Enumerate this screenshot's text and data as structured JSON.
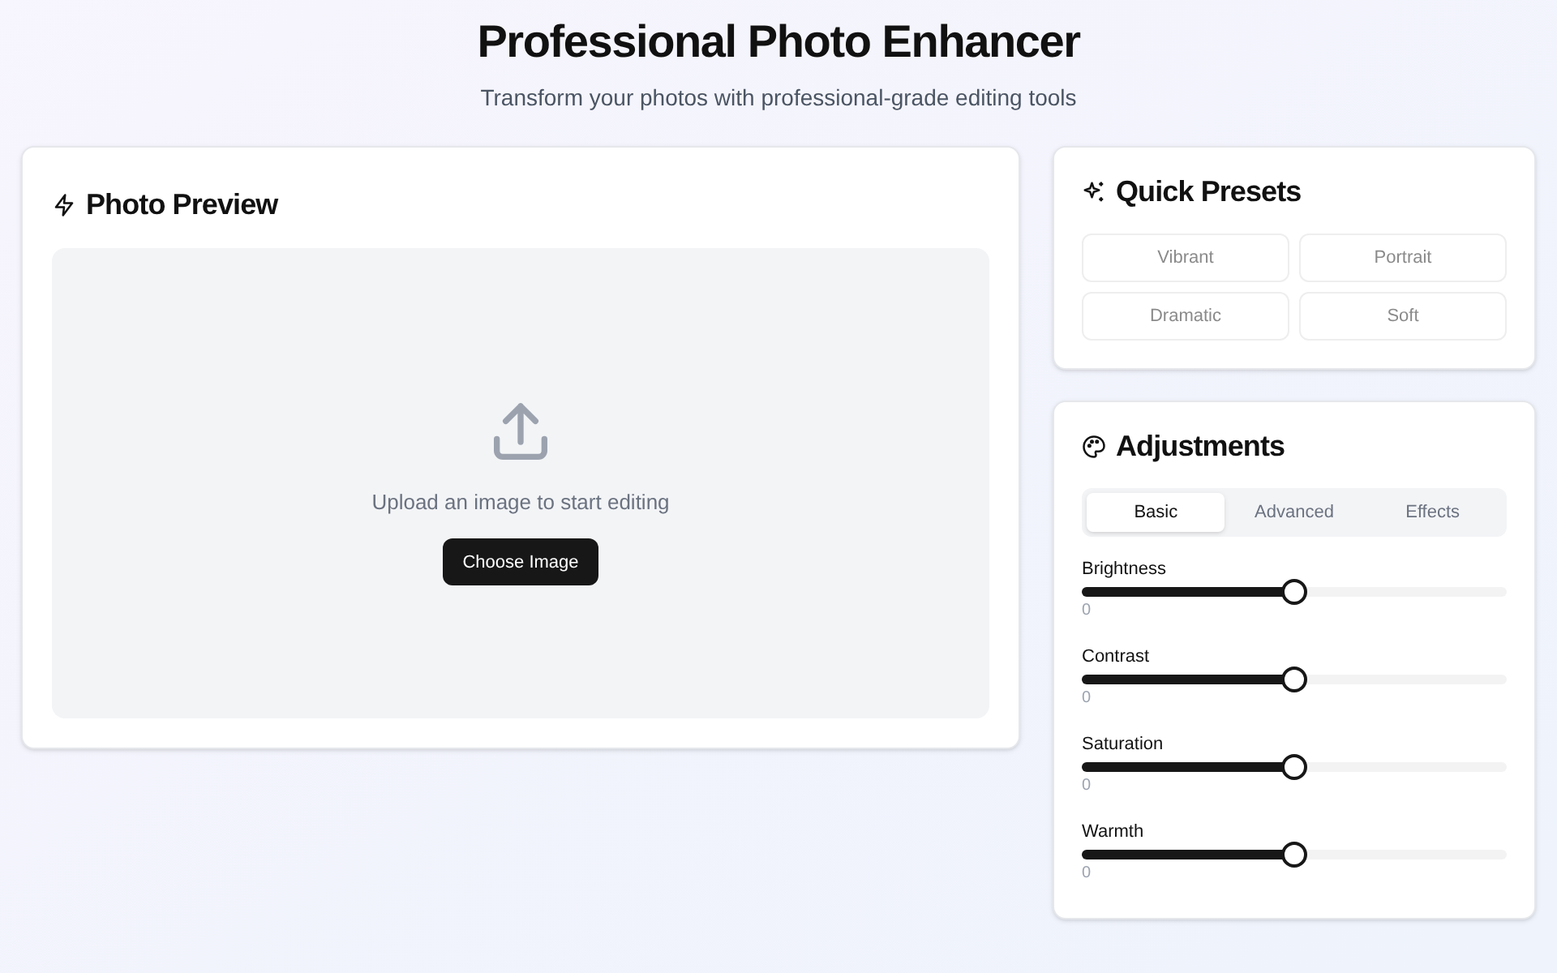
{
  "header": {
    "title": "Professional Photo Enhancer",
    "subtitle": "Transform your photos with professional-grade editing tools"
  },
  "preview": {
    "title": "Photo Preview",
    "prompt": "Upload an image to start editing",
    "button": "Choose Image"
  },
  "presets": {
    "title": "Quick Presets",
    "items": [
      {
        "label": "Vibrant",
        "disabled": true
      },
      {
        "label": "Portrait",
        "disabled": true
      },
      {
        "label": "Dramatic",
        "disabled": true
      },
      {
        "label": "Soft",
        "disabled": true
      }
    ]
  },
  "adjustments": {
    "title": "Adjustments",
    "tabs": [
      {
        "label": "Basic",
        "selected": true
      },
      {
        "label": "Advanced",
        "selected": false
      },
      {
        "label": "Effects",
        "selected": false
      }
    ],
    "sliders": [
      {
        "label": "Brightness",
        "level": 0.5,
        "reading": "0"
      },
      {
        "label": "Contrast",
        "level": 0.5,
        "reading": "0"
      },
      {
        "label": "Saturation",
        "level": 0.5,
        "reading": "0"
      },
      {
        "label": "Warmth",
        "level": 0.5,
        "reading": "0"
      }
    ]
  }
}
